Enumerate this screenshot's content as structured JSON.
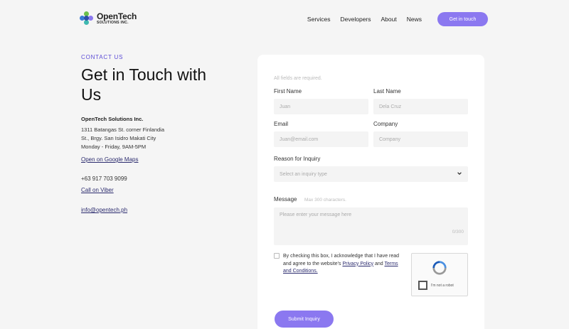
{
  "header": {
    "logo_name": "OpenTech",
    "logo_sub": "SOLUTIONS INC.",
    "nav": [
      "Services",
      "Developers",
      "About",
      "News"
    ],
    "cta": "Get in touch"
  },
  "contact": {
    "eyebrow": "CONTACT US",
    "heading": "Get in Touch with Us",
    "company": "OpenTech Solutions Inc.",
    "address_line1": "1311 Batangas St. corner Finlandia",
    "address_line2": "St., Brgy. San Isidro Makati City",
    "hours": "Monday - Friday, 9AM-5PM",
    "maps_link": "Open on Google Maps",
    "phone": "+63 917 703 9099",
    "viber_link": "Call on Viber",
    "email": "info@opentech.ph"
  },
  "form": {
    "required_note": "All fields are required.",
    "first_name_label": "First Name",
    "first_name_placeholder": "Juan",
    "last_name_label": "Last Name",
    "last_name_placeholder": "Dela Cruz",
    "email_label": "Email",
    "email_placeholder": "Juan@email.com",
    "company_label": "Company",
    "company_placeholder": "Company",
    "reason_label": "Reason for Inquiry",
    "reason_placeholder": "Select an inquiry type",
    "message_label": "Message",
    "message_hint": "Max 300 characters.",
    "message_placeholder": "Please enter your message here",
    "message_count": "0/300",
    "consent_text": "By checking this box, I acknowledge that I have read and agree to the website's",
    "privacy_link": "Privacy Policy",
    "consent_and": "and",
    "terms_link": "Terms and Conditions.",
    "captcha_label": "I'm not a robot",
    "submit": "Submit Inquiry"
  },
  "colors": {
    "accent": "#8b78f0",
    "eyebrow": "#5b4bd6",
    "link": "#2b2b6e"
  }
}
